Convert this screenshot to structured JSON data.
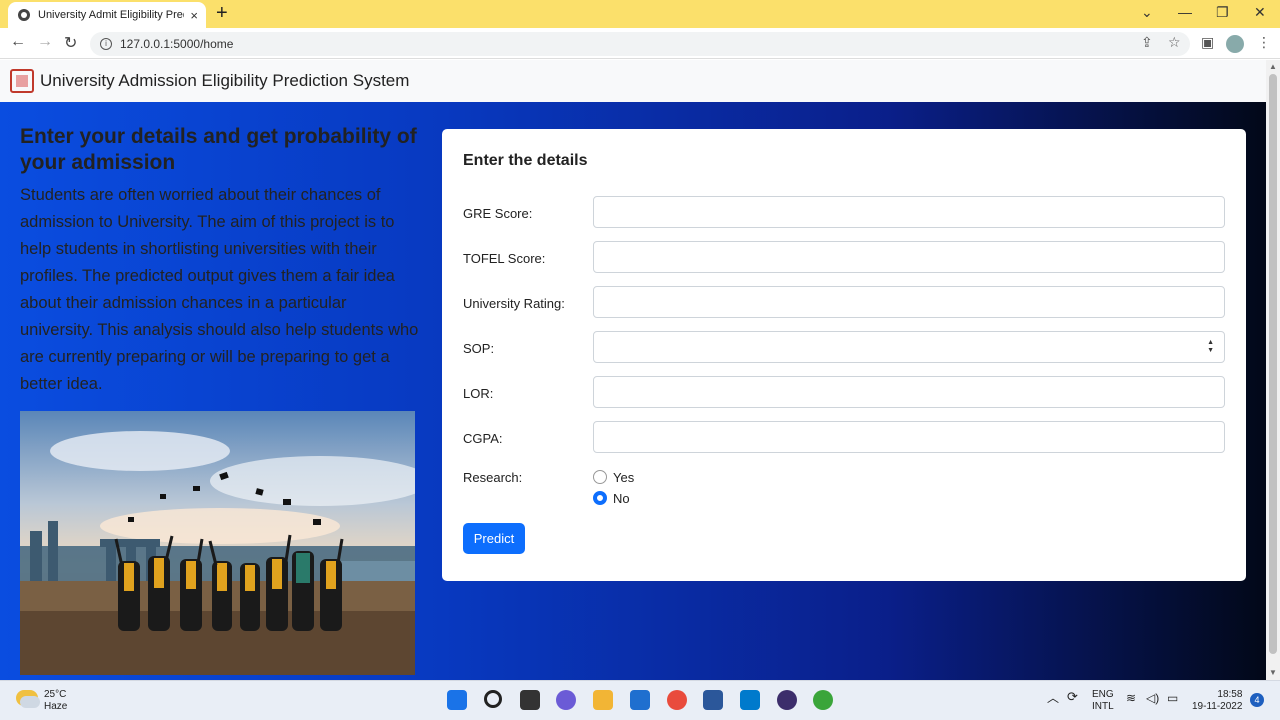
{
  "browser": {
    "tab_title": "University Admit Eligibility Predic",
    "tab_close": "×",
    "new_tab": "+",
    "url": "127.0.0.1:5000/home",
    "back": "←",
    "forward": "→",
    "reload": "↻",
    "minimize": "—",
    "maximize": "❐",
    "close": "✕",
    "tabs_menu": "⌄",
    "share": "⇪",
    "star": "☆",
    "sidepanel": "▣",
    "menu": "⋮"
  },
  "navbar": {
    "brand": "University Admission Eligibility Prediction System"
  },
  "hero": {
    "title": "Enter your details and get probability of your admission",
    "text": "Students are often worried about their chances of admission to University. The aim of this project is to help students in shortlisting universities with their profiles. The predicted output gives them a fair idea about their admission chances in a particular university. This analysis should also help students who are currently preparing or will be preparing to get a better idea."
  },
  "form": {
    "title": "Enter the details",
    "fields": {
      "gre": {
        "label": "GRE Score:",
        "value": ""
      },
      "tofel": {
        "label": "TOFEL Score:",
        "value": ""
      },
      "rating": {
        "label": "University Rating:",
        "value": ""
      },
      "sop": {
        "label": "SOP:",
        "value": ""
      },
      "lor": {
        "label": "LOR:",
        "value": ""
      },
      "cgpa": {
        "label": "CGPA:",
        "value": ""
      }
    },
    "research": {
      "label": "Research:",
      "options": [
        "Yes",
        "No"
      ],
      "selected": "No"
    },
    "predict_label": "Predict"
  },
  "taskbar": {
    "temp": "25°C",
    "condition": "Haze",
    "lang1": "ENG",
    "lang2": "INTL",
    "time": "18:58",
    "date": "19-11-2022",
    "notifications": "4"
  },
  "colors": {
    "accent": "#0d6efd",
    "tabbar": "#fbe06b"
  }
}
